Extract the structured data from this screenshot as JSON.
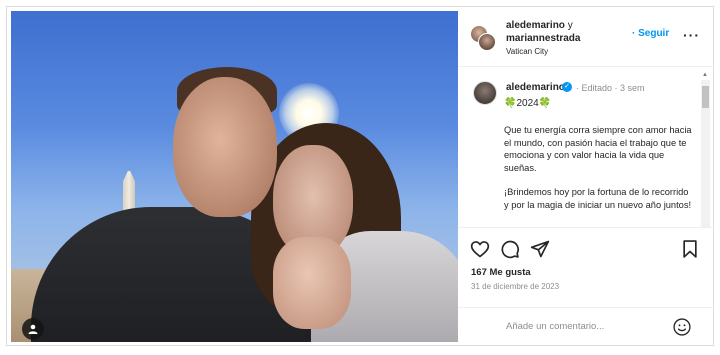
{
  "post": {
    "photo_alt_icon": "user-tag-icon"
  },
  "header": {
    "user1": "aledemarino",
    "joiner": "y",
    "user2": "mariannestrada",
    "location": "Vatican City",
    "follow_label": "· Seguir",
    "more_label": "···"
  },
  "caption": {
    "username": "aledemarino",
    "meta": "· Editado · 3 sem",
    "emoji_line": "🍀2024🍀",
    "paragraph1": "Que tu energía corra siempre con amor hacia el mundo, con pasión hacia el trabajo que te emociona y con valor hacia la vida que sueñas.",
    "paragraph2": "¡Brindemos hoy por la fortuna de lo recorrido y por la magia de iniciar un nuevo año juntos!"
  },
  "stats": {
    "likes": "167 Me gusta",
    "date": "31 de diciembre de 2023"
  },
  "comment": {
    "placeholder": "Añade un comentario..."
  },
  "colors": {
    "accent": "#0095f6",
    "text": "#262626",
    "muted": "#8e8e8e"
  }
}
